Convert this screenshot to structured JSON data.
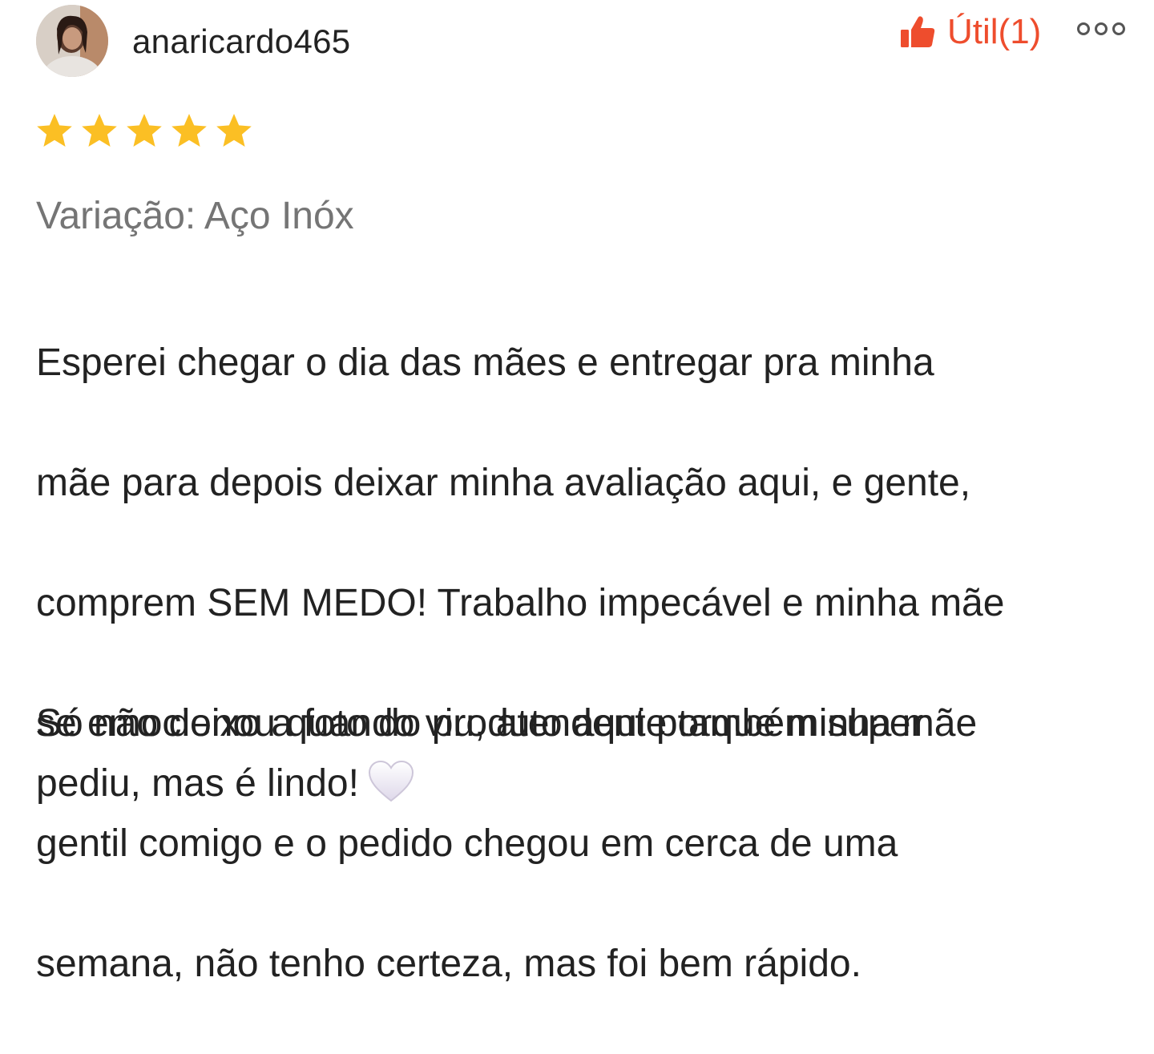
{
  "review": {
    "username": "anaricardo465",
    "helpful_label": "Útil(1)",
    "rating": 5,
    "rating_max": 5,
    "variation": "Variação: Aço Inóx",
    "body_lines": [
      "Esperei chegar o dia das mães e entregar pra minha",
      "mãe para depois deixar minha avaliação aqui, e gente,",
      "comprem SEM MEDO! Trabalho impecável e minha mãe",
      "se emocionou quando viu, atendente também super",
      "gentil comigo e o pedido chegou em cerca de uma",
      "semana, não tenho certeza, mas foi bem rápido."
    ],
    "second_paragraph_lines": [
      "Só não deixo a foto do produto aqui porque minha mãe",
      "pediu, mas é lindo!"
    ]
  },
  "icons": {
    "helpful": "thumbs-up-icon",
    "more": "more-options-icon",
    "star": "star-icon",
    "emoji": "white-heart-icon"
  },
  "colors": {
    "accent": "#ee4d2d",
    "star": "#fbbf24",
    "muted_text": "#757575",
    "text": "#222222"
  }
}
